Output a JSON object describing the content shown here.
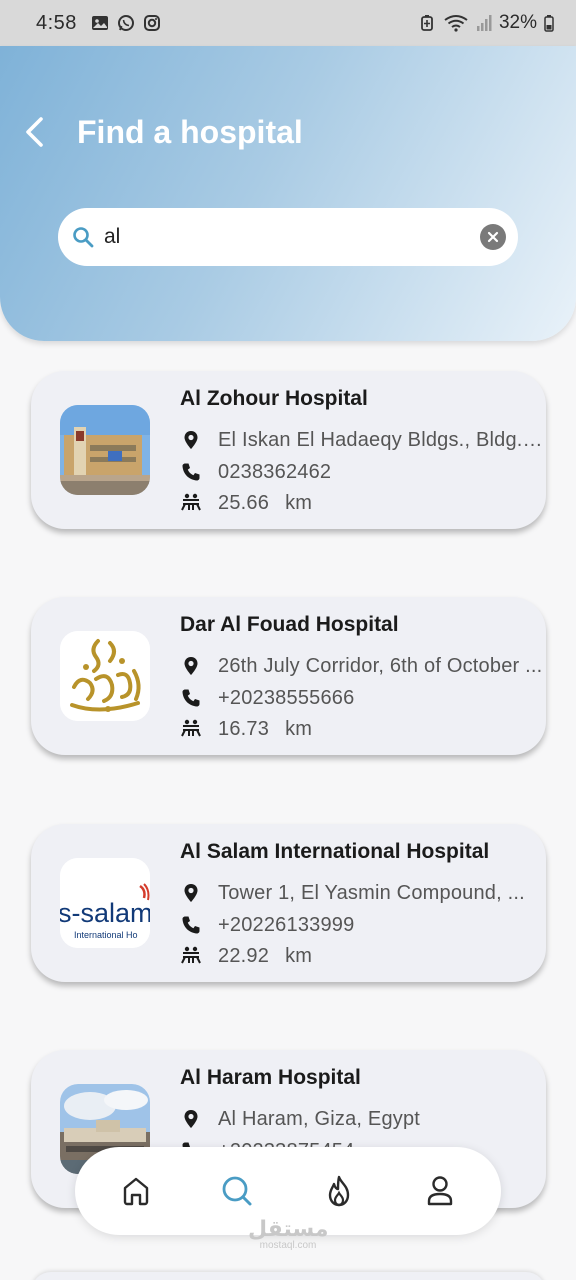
{
  "status_bar": {
    "time": "4:58",
    "battery": "32%"
  },
  "header": {
    "title": "Find a hospital"
  },
  "search": {
    "value": "al"
  },
  "hospitals": [
    {
      "name": "Al Zohour Hospital",
      "address": "El Iskan El Hadaeqy Bldgs., Bldg. ...",
      "phone": "0238362462",
      "distance": "25.66",
      "unit": "km"
    },
    {
      "name": "Dar Al Fouad Hospital",
      "address": "26th July Corridor, 6th of October ...",
      "phone": "+20238555666",
      "distance": "16.73",
      "unit": "km"
    },
    {
      "name": "Al Salam International Hospital",
      "address": "Tower 1, El Yasmin Compound, ...",
      "phone": "+20226133999",
      "distance": "22.92",
      "unit": "km"
    },
    {
      "name": "Al Haram Hospital",
      "address": "Al Haram, Giza, Egypt",
      "phone": "+20233875454",
      "distance": "",
      "unit": ""
    }
  ],
  "logos": {
    "al_salam_text": "s-salam",
    "al_salam_sub": "International Ho"
  },
  "nav": {
    "items": [
      "home",
      "search",
      "fire",
      "profile"
    ],
    "active": "search",
    "active_color": "#4a9cc4"
  },
  "watermark": {
    "main": "مستقل",
    "sub": "mostaql.com"
  },
  "colors": {
    "header_start": "#7fb2d8",
    "header_end": "#e9f2f9",
    "card_bg": "#eff0f5"
  }
}
